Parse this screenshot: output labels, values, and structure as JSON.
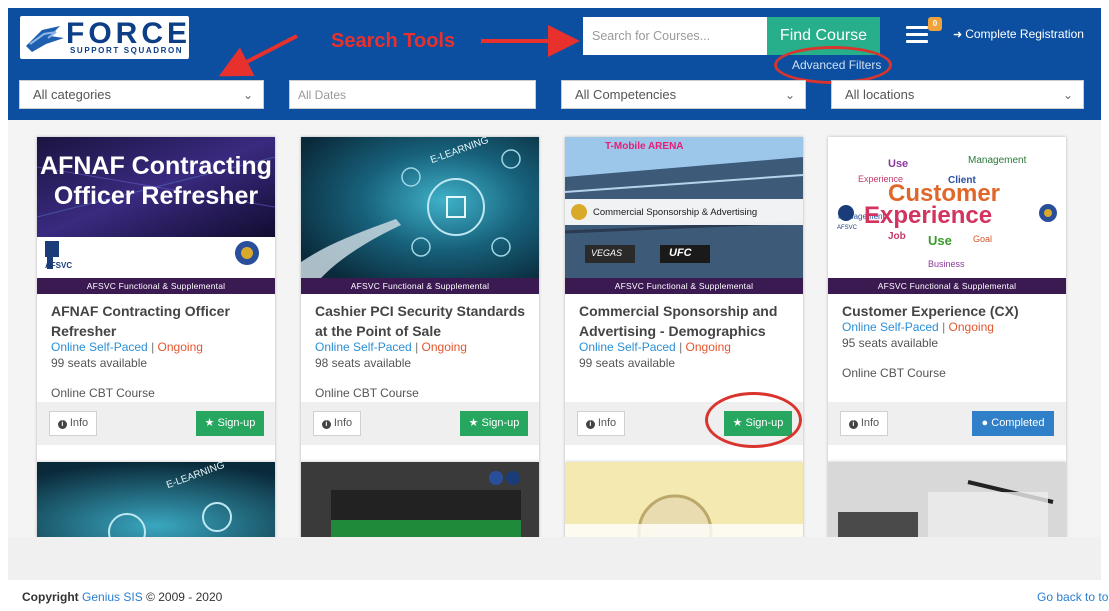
{
  "header": {
    "logo_text": "FORCE",
    "logo_subtext": "SUPPORT SQUADRON",
    "annotation_label": "Search Tools",
    "search": {
      "placeholder": "Search for Courses..."
    },
    "find_button": "Find Course",
    "advanced_filters": "Advanced Filters",
    "cart_badge": "0",
    "complete_registration": "Complete Registration",
    "accent_color": "#0c4ea0",
    "annotation_color": "#e8312d"
  },
  "filters": {
    "categories": "All categories",
    "dates_placeholder": "All Dates",
    "competencies": "All Competencies",
    "locations": "All locations"
  },
  "cards": [
    {
      "image_title_line1": "AFNAF Contracting",
      "image_title_line2": "Officer Refresher",
      "image_badge": "AFSVC",
      "strip": "AFSVC Functional & Supplemental",
      "title": "AFNAF Contracting Officer Refresher",
      "delivery": "Online Self-Paced",
      "separator": "|",
      "status": "Ongoing",
      "seats": "99 seats available",
      "course_type": "Online CBT Course",
      "info_label": "Info",
      "action_label": "Sign-up"
    },
    {
      "image_title_line1": "E-LEARNING",
      "strip": "AFSVC Functional & Supplemental",
      "title": "Cashier PCI Security Standards at the Point of Sale",
      "delivery": "Online Self-Paced",
      "separator": "|",
      "status": "Ongoing",
      "seats": "98 seats available",
      "course_type": "Online CBT Course",
      "info_label": "Info",
      "action_label": "Sign-up"
    },
    {
      "image_title_line1": "Commercial Sponsorship & Advertising",
      "image_arena_sign": "T-Mobile ARENA",
      "image_board_1": "VEGAS",
      "image_board_2": "UFC",
      "strip": "AFSVC Functional & Supplemental",
      "title": "Commercial Sponsorship and Advertising - Demographics",
      "delivery": "Online Self-Paced",
      "separator": "|",
      "status": "Ongoing",
      "seats": "99 seats available",
      "course_type": "",
      "info_label": "Info",
      "action_label": "Sign-up"
    },
    {
      "image_title_line1": "Customer",
      "image_title_line2": "Experience",
      "image_badge": "AFSVC",
      "strip": "AFSVC Functional & Supplemental",
      "title": "Customer Experience (CX)",
      "delivery": "Online Self-Paced",
      "separator": "|",
      "status": "Ongoing",
      "seats": "95 seats available",
      "course_type": "Online CBT Course",
      "info_label": "Info",
      "action_label": "Completed"
    }
  ],
  "second_row": {
    "card1_text": "E-LEARNING"
  },
  "footer": {
    "copyright_label": "Copyright",
    "company": "Genius SIS",
    "years": "© 2009 - 2020",
    "back_to_top": "Go back to top"
  }
}
